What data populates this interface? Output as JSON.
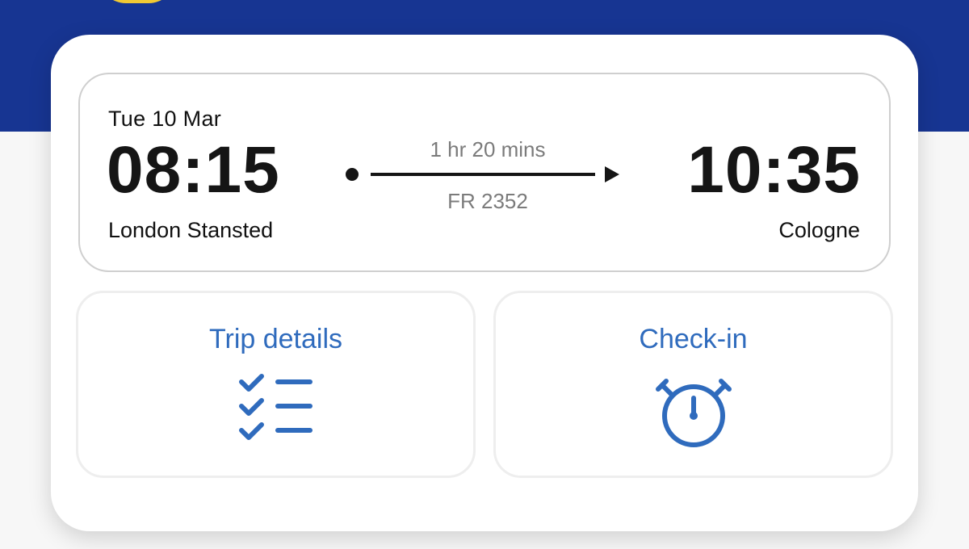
{
  "colors": {
    "header_band": "#173592",
    "accent_blue": "#2f6bbd",
    "avatar_yellow": "#f1c933"
  },
  "flight": {
    "date": "Tue 10 Mar",
    "departure": {
      "time": "08:15",
      "airport": "London Stansted"
    },
    "arrival": {
      "time": "10:35",
      "airport": "Cologne"
    },
    "duration": "1 hr 20 mins",
    "flight_number": "FR 2352"
  },
  "actions": [
    {
      "label": "Trip details",
      "icon": "checklist-icon"
    },
    {
      "label": "Check-in",
      "icon": "stopwatch-icon"
    }
  ]
}
